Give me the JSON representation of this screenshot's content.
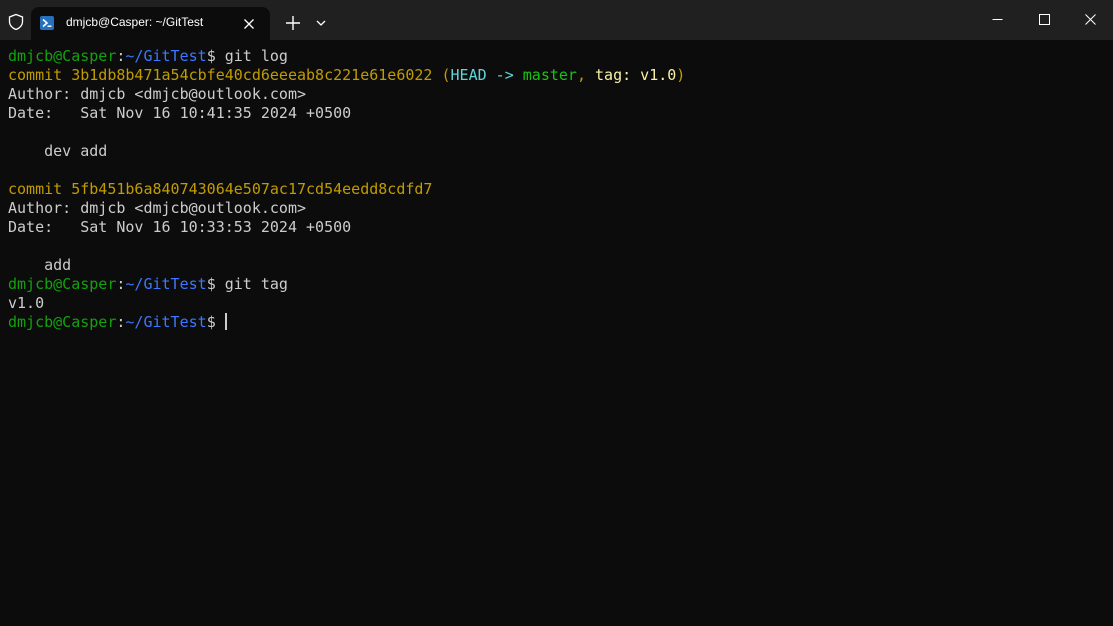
{
  "titlebar": {
    "tab_title": "dmjcb@Casper: ~/GitTest"
  },
  "icons": {
    "shield": "shield-icon",
    "tab": "powershell-icon",
    "close": "close-icon",
    "plus": "plus-icon",
    "dropdown": "chevron-down-icon",
    "minimize": "minimize-icon",
    "maximize": "maximize-icon",
    "window_close": "window-close-icon"
  },
  "colors": {
    "background": "#0c0c0c",
    "titlebar": "#202020",
    "prompt_user": "#13a10e",
    "prompt_path": "#3b78ff",
    "commit_hash": "#c19c00",
    "head": "#61d6d6",
    "branch": "#16c60c",
    "tag": "#f9f1a5",
    "text": "#cccccc"
  },
  "terminal": {
    "prompt_user": "dmjcb@Casper",
    "prompt_sep": ":",
    "prompt_path": "~/GitTest",
    "prompt_dollar": "$ ",
    "cmd1": "git log",
    "commit1": {
      "hash_line": "commit 3b1db8b471a54cbfe40cd6eeeab8c221e61e6022",
      "paren_open": " (",
      "head": "HEAD -> ",
      "branch": "master",
      "comma": ", ",
      "tag": "tag: v1.0",
      "paren_close": ")",
      "author": "Author: dmjcb <dmjcb@outlook.com>",
      "date": "Date:   Sat Nov 16 10:41:35 2024 +0500",
      "message": "    dev add"
    },
    "commit2": {
      "hash_line": "commit 5fb451b6a840743064e507ac17cd54eedd8cdfd7",
      "author": "Author: dmjcb <dmjcb@outlook.com>",
      "date": "Date:   Sat Nov 16 10:33:53 2024 +0500",
      "message": "    add"
    },
    "cmd2": "git tag",
    "tag_output": "v1.0"
  }
}
